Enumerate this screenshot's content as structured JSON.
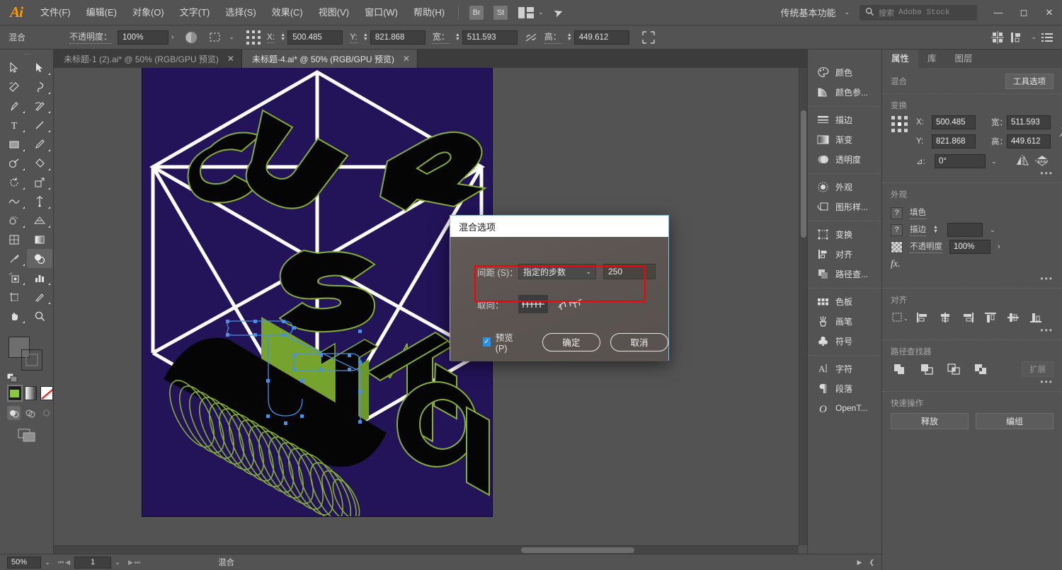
{
  "app": {
    "name": "Adobe Illustrator",
    "logo": "Ai"
  },
  "menubar": {
    "items": [
      {
        "label": "文件(F)"
      },
      {
        "label": "编辑(E)"
      },
      {
        "label": "对象(O)"
      },
      {
        "label": "文字(T)"
      },
      {
        "label": "选择(S)"
      },
      {
        "label": "效果(C)"
      },
      {
        "label": "视图(V)"
      },
      {
        "label": "窗口(W)"
      },
      {
        "label": "帮助(H)"
      }
    ],
    "bridge_badge": "Br",
    "stock_badge": "St",
    "arrange_icon": "arrange-documents-icon",
    "chevron_icon": "chevron-down-icon",
    "rocket_icon": "rocket-icon",
    "workspace": "传统基本功能",
    "workspace_chevron": "chevron-down-icon",
    "search_icon": "search-icon",
    "search_placeholder": "搜索",
    "search_suffix": "Adobe Stock",
    "window_min": "—",
    "window_max": "◻",
    "window_close": "✕"
  },
  "controlbar": {
    "selection_label": "混合",
    "opacity_label": "不透明度：",
    "opacity_value": "100%",
    "opacity_arrow": "›",
    "opacity_swatch_icon": "opacity-swatch-icon",
    "select_similar_icon": "select-similar-icon",
    "reference_point_icon": "reference-point-grid-icon",
    "x_label": "X:",
    "x_value": "500.485",
    "y_label": "Y:",
    "y_value": "821.868",
    "w_label": "宽：",
    "w_value": "511.593",
    "link_icon": "link-broken-icon",
    "h_label": "高：",
    "h_value": "449.612",
    "transform_icon": "transform-icon",
    "right_icons": [
      "align-icon",
      "distribute-icon",
      "chevron-down-icon",
      "panel-menu-icon"
    ]
  },
  "tabs": [
    {
      "label": "未标题-1 (2).ai* @ 50% (RGB/GPU 预览)",
      "close": "✕",
      "active": false
    },
    {
      "label": "未标题-4.ai* @ 50% (RGB/GPU 预览)",
      "close": "✕",
      "active": true
    }
  ],
  "toolbar": {
    "tools": [
      {
        "name": "selection-tool",
        "glyph": "▷"
      },
      {
        "name": "direct-selection-tool",
        "glyph": "▶"
      },
      {
        "name": "magic-wand-tool",
        "glyph": "✦"
      },
      {
        "name": "lasso-tool",
        "glyph": "◠"
      },
      {
        "name": "pen-tool",
        "glyph": "✒"
      },
      {
        "name": "curvature-tool",
        "glyph": "✎"
      },
      {
        "name": "type-tool",
        "glyph": "T"
      },
      {
        "name": "line-segment-tool",
        "glyph": "／"
      },
      {
        "name": "rectangle-tool",
        "glyph": "▭"
      },
      {
        "name": "paintbrush-tool",
        "glyph": "🖌"
      },
      {
        "name": "shaper-tool",
        "glyph": "◌"
      },
      {
        "name": "eraser-tool",
        "glyph": "◇"
      },
      {
        "name": "rotate-tool",
        "glyph": "↺"
      },
      {
        "name": "scale-tool",
        "glyph": "⤢"
      },
      {
        "name": "width-tool",
        "glyph": "∿"
      },
      {
        "name": "free-transform-tool",
        "glyph": "✚"
      },
      {
        "name": "shape-builder-tool",
        "glyph": "◕"
      },
      {
        "name": "perspective-grid-tool",
        "glyph": "▧"
      },
      {
        "name": "mesh-tool",
        "glyph": "▦"
      },
      {
        "name": "gradient-tool",
        "glyph": "▤"
      },
      {
        "name": "eyedropper-tool",
        "glyph": "⌇"
      },
      {
        "name": "blend-tool",
        "glyph": "◒",
        "selected": true
      },
      {
        "name": "symbol-sprayer-tool",
        "glyph": "◎"
      },
      {
        "name": "column-graph-tool",
        "glyph": "▥"
      },
      {
        "name": "artboard-tool",
        "glyph": "⊡"
      },
      {
        "name": "slice-tool",
        "glyph": "✂"
      },
      {
        "name": "hand-tool",
        "glyph": "✋"
      },
      {
        "name": "zoom-tool",
        "glyph": "🔍"
      }
    ],
    "fill_swatch_name": "fill-swatch",
    "stroke_swatch_name": "stroke-swatch",
    "color_mode_name": "color-mode-button",
    "gradient_mode_name": "gradient-mode-button",
    "none_mode_name": "none-mode-button",
    "draw_normal": "draw-normal-button",
    "draw_behind": "draw-behind-button",
    "draw_inside": "draw-inside-button",
    "screen_mode": "change-screen-mode-button"
  },
  "canvas": {
    "artboard_bg": "#231359",
    "green": "#76a22e",
    "black": "#050505",
    "white": "#ffffff",
    "selection_blue": "#4a90e2",
    "artwork_text_letters": [
      "C",
      "U",
      "R",
      "S",
      "T",
      "Y",
      "O",
      "I"
    ]
  },
  "dialog": {
    "title": "混合选项",
    "spacing_label": "间距 (S)：",
    "spacing_option": "指定的步数",
    "spacing_chevron": "chevron-down-icon",
    "steps_value": "250",
    "orientation_label": "取向：",
    "orientation_page_icon": "align-to-page-icon",
    "orientation_path_icon": "align-to-path-icon",
    "preview_label": "预览 (P)",
    "preview_checked": true,
    "ok_label": "确定",
    "cancel_label": "取消",
    "highlight_color": "#ff0000"
  },
  "dock": {
    "groups": [
      {
        "items": [
          {
            "icon": "color-palette-icon",
            "label": "颜色"
          },
          {
            "icon": "color-guide-icon",
            "label": "颜色参..."
          }
        ]
      },
      {
        "items": [
          {
            "icon": "stroke-icon",
            "label": "描边"
          },
          {
            "icon": "gradient-icon",
            "label": "渐变"
          },
          {
            "icon": "transparency-icon",
            "label": "透明度"
          }
        ]
      },
      {
        "items": [
          {
            "icon": "appearance-icon",
            "label": "外观"
          },
          {
            "icon": "graphic-styles-icon",
            "label": "图形样..."
          }
        ]
      },
      {
        "items": [
          {
            "icon": "transform-icon",
            "label": "变换"
          },
          {
            "icon": "align-icon",
            "label": "对齐"
          },
          {
            "icon": "pathfinder-icon",
            "label": "路径查..."
          }
        ]
      },
      {
        "items": [
          {
            "icon": "swatches-icon",
            "label": "色板"
          },
          {
            "icon": "brushes-icon",
            "label": "画笔"
          },
          {
            "icon": "symbols-icon",
            "label": "符号"
          }
        ]
      },
      {
        "items": [
          {
            "icon": "character-icon",
            "label": "字符"
          },
          {
            "icon": "paragraph-icon",
            "label": "段落"
          },
          {
            "icon": "opentype-icon",
            "label": "OpenT..."
          }
        ]
      }
    ]
  },
  "properties": {
    "tabs": [
      {
        "label": "属性",
        "active": true
      },
      {
        "label": "库",
        "active": false
      },
      {
        "label": "图层",
        "active": false
      }
    ],
    "object_type_label": "混合",
    "tool_options_button": "工具选项",
    "transform": {
      "heading": "变换",
      "ref_point_icon": "reference-point-grid-icon",
      "x_label": "X:",
      "x_value": "500.485",
      "y_label": "Y:",
      "y_value": "821.868",
      "w_label": "宽：",
      "w_value": "511.593",
      "h_label": "高：",
      "h_value": "449.612",
      "link_icon": "link-broken-icon",
      "angle_label": "⊿:",
      "angle_value": "0°",
      "angle_chevron": "chevron-down-icon",
      "flip_h_icon": "flip-horizontal-icon",
      "flip_v_icon": "flip-vertical-icon",
      "more_options": "•••"
    },
    "appearance": {
      "heading": "外观",
      "fill_label": "填色",
      "fill_swatch": "?",
      "stroke_label": "描边",
      "stroke_swatch": "?",
      "stroke_width_value": "",
      "stroke_chevron": "chevron-down-icon",
      "opacity_icon": "transparency-checker-icon",
      "opacity_label": "不透明度",
      "opacity_value": "100%",
      "opacity_arrow": "›",
      "fx_label": "fx.",
      "more_options": "•••"
    },
    "align": {
      "heading": "对齐",
      "buttons": [
        "align-to-selection-icon",
        "align-left-icon",
        "align-center-h-icon",
        "align-right-icon",
        "align-top-icon",
        "align-center-v-icon",
        "align-bottom-icon"
      ],
      "more_options": "•••"
    },
    "pathfinder": {
      "heading": "路径查找器",
      "buttons": [
        "unite-icon",
        "minus-front-icon",
        "intersect-icon",
        "exclude-icon"
      ],
      "expand_label": "扩展",
      "more_options": "•••"
    },
    "quick_actions": {
      "heading": "快速操作",
      "release_label": "释放",
      "group_label": "编组"
    }
  },
  "statusbar": {
    "zoom_value": "50%",
    "zoom_chevron": "chevron-down-icon",
    "first_page_icon": "first-page-icon",
    "prev_page_icon": "prev-page-icon",
    "page_value": "1",
    "page_chevron": "chevron-down-icon",
    "next_page_icon": "next-page-icon",
    "last_page_icon": "last-page-icon",
    "status_text": "混合",
    "right_icons": [
      "play-icon",
      "chevron-left-icon"
    ]
  }
}
